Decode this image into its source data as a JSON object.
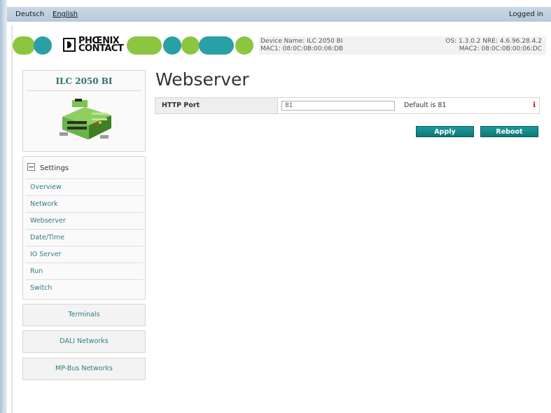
{
  "topbar": {
    "languages": [
      "Deutsch",
      "English"
    ],
    "status": "Logged in"
  },
  "header": {
    "brand": {
      "line1": "PHŒNIX",
      "line2": "CONTACT"
    },
    "device_name": "Device Name: ILC 2050 BI",
    "mac1": "MAC1: 08:0C:0B:00:06:DB",
    "versions": "OS: 1.3.0.2 NRE: 4.6.96.28.4.2",
    "mac2": "MAC2: 08:0C:0B:00:06:DC",
    "colors": {
      "green": "#8cc640",
      "teal": "#2a9fa6"
    }
  },
  "device_panel": {
    "title": "ILC 2050 BI"
  },
  "settings": {
    "heading": "Settings",
    "items": [
      "Overview",
      "Network",
      "Webserver",
      "Date/Time",
      "IO Server",
      "Run",
      "Switch"
    ]
  },
  "groups": [
    "Terminals",
    "DALI Networks",
    "MP-Bus Networks"
  ],
  "main": {
    "title": "Webserver",
    "http_port": {
      "label": "HTTP Port",
      "value": "81",
      "hint": "Default is 81",
      "info_icon": "i"
    },
    "buttons": {
      "apply": "Apply",
      "reboot": "Reboot"
    },
    "accent": "#138585"
  }
}
